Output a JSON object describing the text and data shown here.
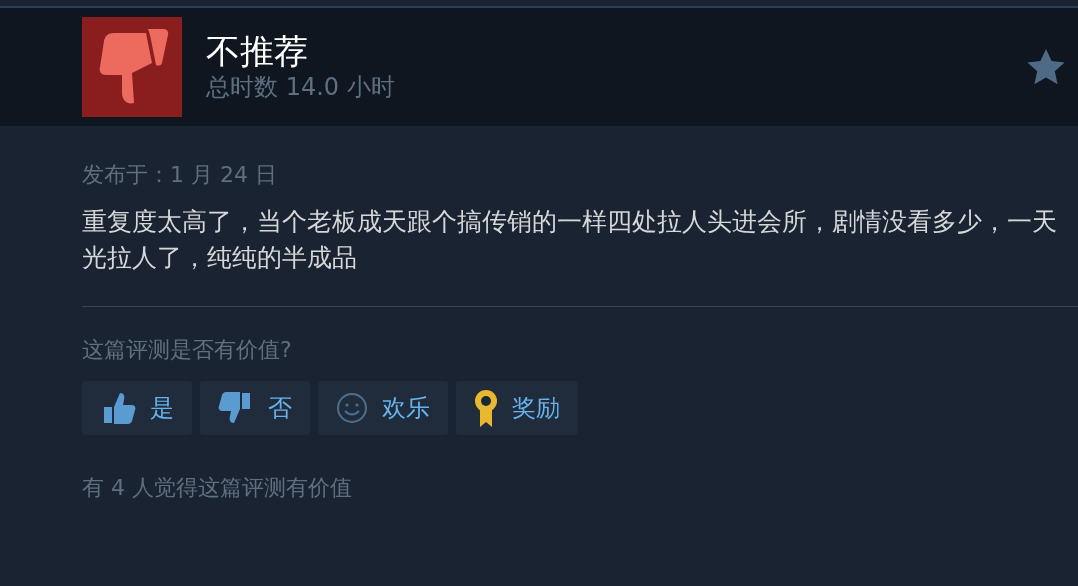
{
  "review": {
    "verdict": "不推荐",
    "recommended": false,
    "playtime": "总时数 14.0 小时",
    "posted": "发布于：1 月 24 日",
    "text": "重复度太高了，当个老板成天跟个搞传销的一样四处拉人头进会所，剧情没看多少，一天光拉人了，纯纯的半成品"
  },
  "feedback": {
    "question": "这篇评测是否有价值?",
    "buttons": [
      {
        "kind": "yes",
        "label": "是"
      },
      {
        "kind": "no",
        "label": "否"
      },
      {
        "kind": "funny",
        "label": "欢乐"
      },
      {
        "kind": "award",
        "label": "奖励"
      }
    ],
    "summary": "有 4 人觉得这篇评测有价值"
  }
}
